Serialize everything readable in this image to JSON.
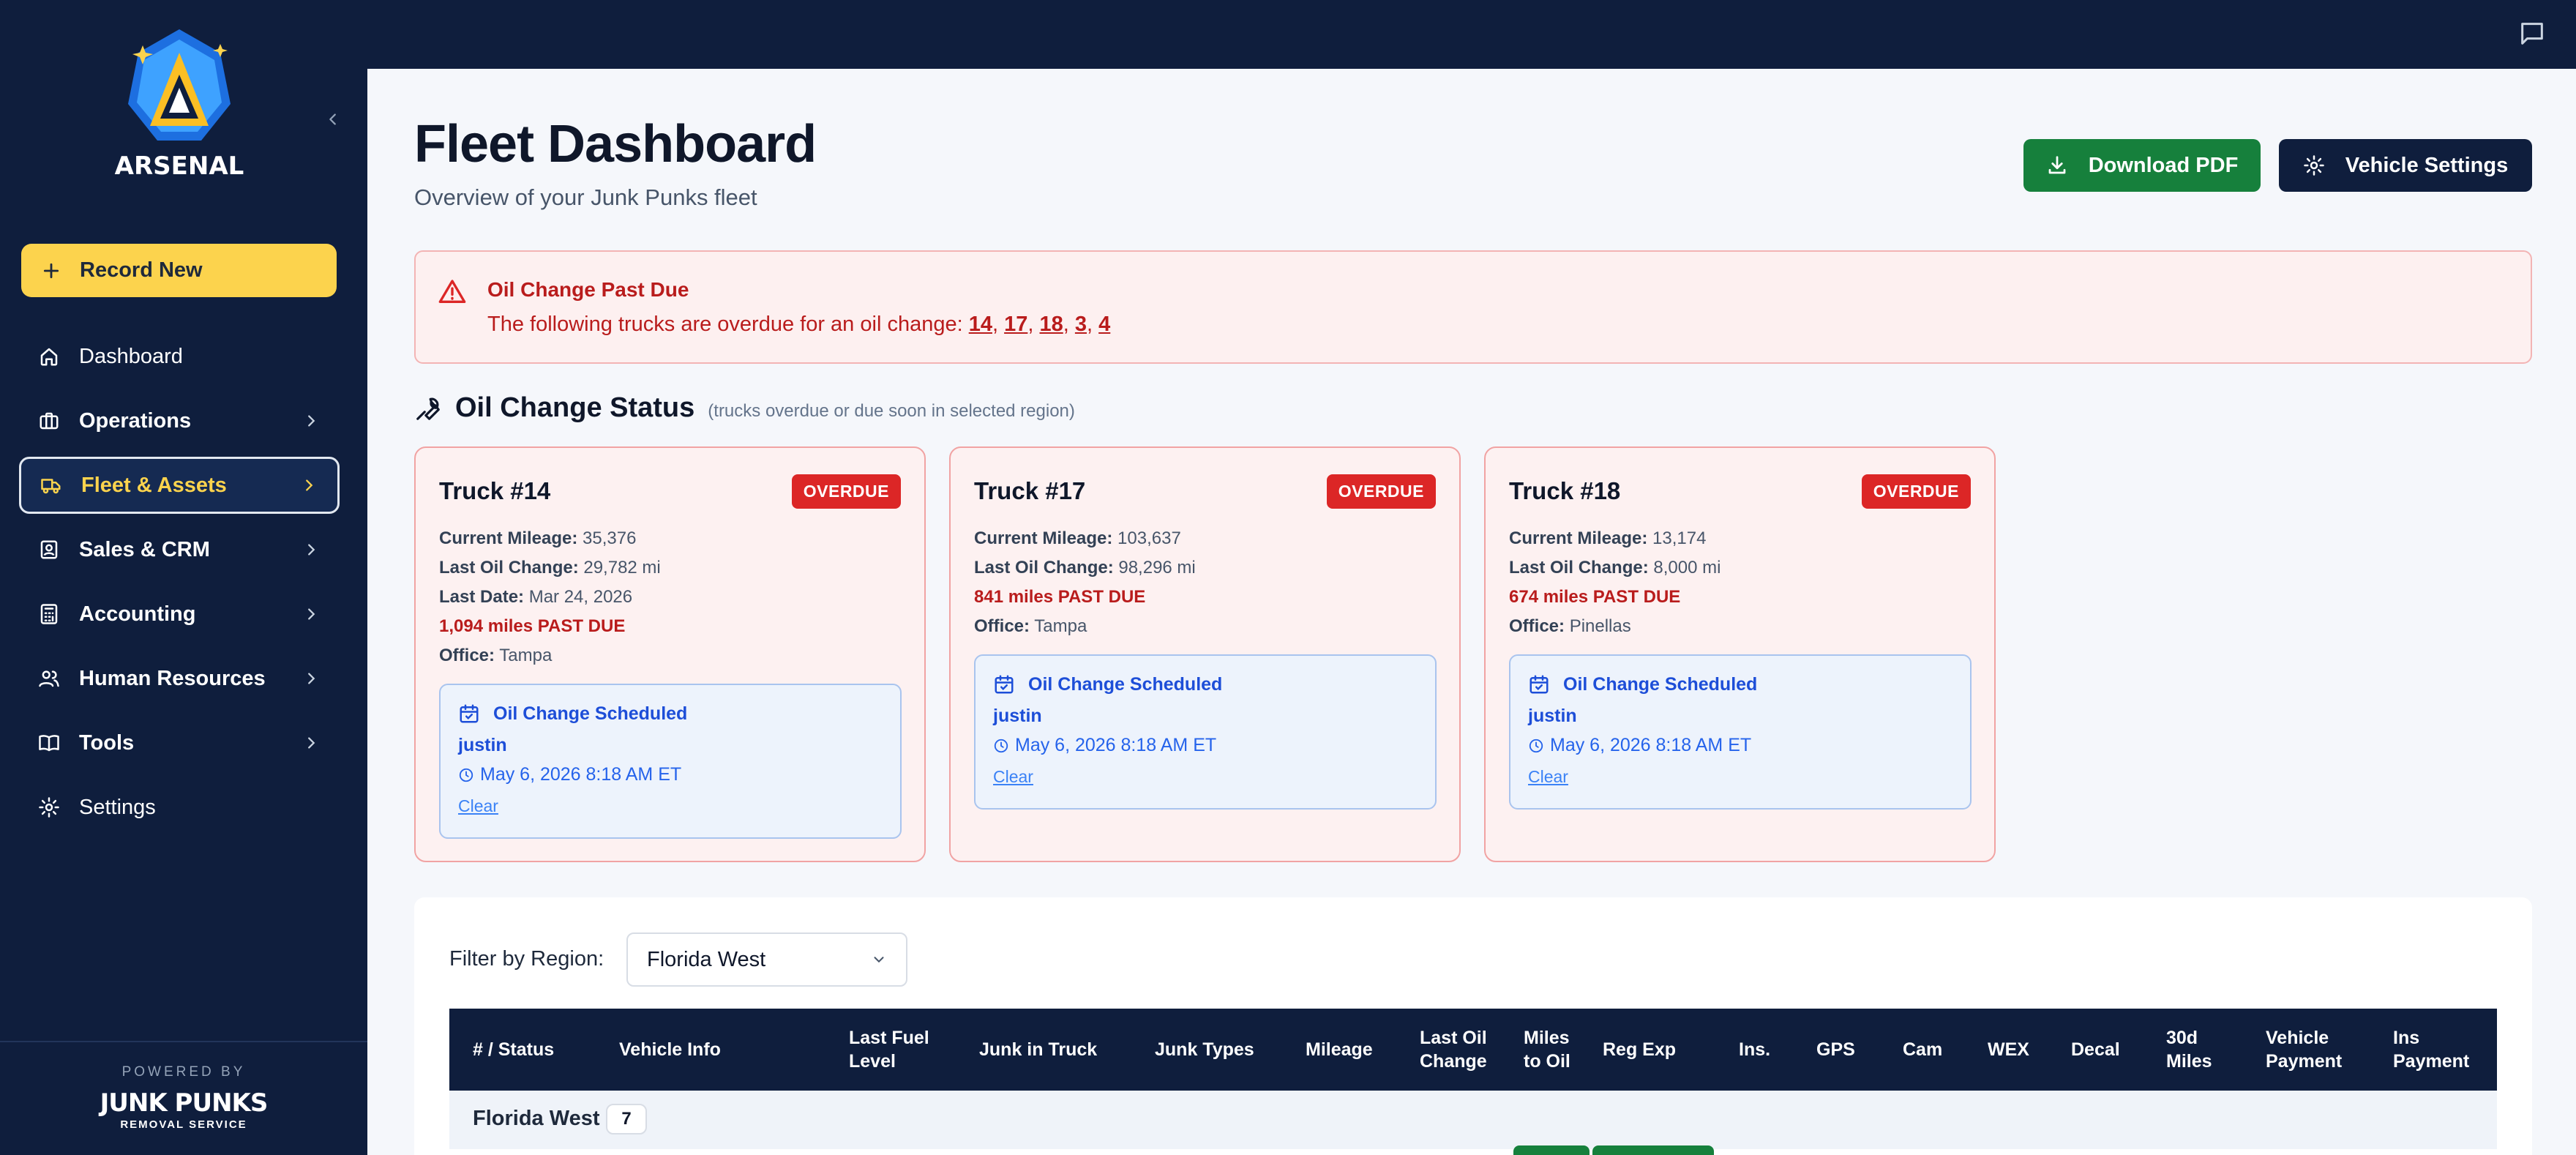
{
  "sidebar": {
    "brand": "ARSENAL",
    "record_new": "Record New",
    "items": [
      {
        "label": "Dashboard",
        "icon": "home-icon",
        "chevron": false
      },
      {
        "label": "Operations",
        "icon": "briefcase-icon",
        "chevron": true
      },
      {
        "label": "Fleet & Assets",
        "icon": "truck-icon",
        "chevron": true,
        "active": true
      },
      {
        "label": "Sales & CRM",
        "icon": "contact-icon",
        "chevron": true
      },
      {
        "label": "Accounting",
        "icon": "calculator-icon",
        "chevron": true
      },
      {
        "label": "Human Resources",
        "icon": "users-icon",
        "chevron": true
      },
      {
        "label": "Tools",
        "icon": "book-icon",
        "chevron": true
      },
      {
        "label": "Settings",
        "icon": "gear-icon",
        "chevron": false
      }
    ],
    "powered_by": "POWERED BY",
    "footer_logo": "JUNK PUNKS",
    "footer_logo_sub": "REMOVAL SERVICE"
  },
  "header": {
    "title": "Fleet Dashboard",
    "subtitle": "Overview of your Junk Punks fleet",
    "download_pdf": "Download PDF",
    "vehicle_settings": "Vehicle Settings"
  },
  "alert": {
    "title": "Oil Change Past Due",
    "text": "The following trucks are overdue for an oil change: ",
    "trucks": [
      "14",
      "17",
      "18",
      "3",
      "4"
    ],
    "sep": ", "
  },
  "oil_status": {
    "title": "Oil Change Status",
    "note": "(trucks overdue or due soon in selected region)"
  },
  "cards": [
    {
      "title": "Truck #14",
      "badge": "OVERDUE",
      "mileage_label": "Current Mileage:",
      "mileage": "35,376",
      "last_label": "Last Oil Change:",
      "last": "29,782 mi",
      "date_label": "Last Date:",
      "date": "Mar 24, 2026",
      "due": "1,094 miles PAST DUE",
      "office_label": "Office:",
      "office": "Tampa",
      "sched_title": "Oil Change Scheduled",
      "sched_user": "justin",
      "sched_time": "May 6, 2026 8:18 AM ET",
      "clear": "Clear"
    },
    {
      "title": "Truck #17",
      "badge": "OVERDUE",
      "mileage_label": "Current Mileage:",
      "mileage": "103,637",
      "last_label": "Last Oil Change:",
      "last": "98,296 mi",
      "due": "841 miles PAST DUE",
      "office_label": "Office:",
      "office": "Tampa",
      "sched_title": "Oil Change Scheduled",
      "sched_user": "justin",
      "sched_time": "May 6, 2026 8:18 AM ET",
      "clear": "Clear"
    },
    {
      "title": "Truck #18",
      "badge": "OVERDUE",
      "mileage_label": "Current Mileage:",
      "mileage": "13,174",
      "last_label": "Last Oil Change:",
      "last": "8,000 mi",
      "due": "674 miles PAST DUE",
      "office_label": "Office:",
      "office": "Pinellas",
      "sched_title": "Oil Change Scheduled",
      "sched_user": "justin",
      "sched_time": "May 6, 2026 8:18 AM ET",
      "clear": "Clear"
    }
  ],
  "filter": {
    "label": "Filter by Region:",
    "value": "Florida West"
  },
  "table": {
    "columns": [
      "# / Status",
      "Vehicle Info",
      "Last Fuel Level",
      "Junk in Truck",
      "Junk Types",
      "Mileage",
      "Last Oil Change",
      "Miles to Oil",
      "Reg Exp",
      "Ins.",
      "GPS",
      "Cam",
      "WEX",
      "Decal",
      "30d Miles",
      "Vehicle Payment",
      "Ins Payment"
    ],
    "group": {
      "name": "Florida West",
      "count": "7"
    }
  },
  "colors": {
    "navy": "#0f1e3d",
    "accent_yellow": "#fcd34d",
    "success_green": "#16803c",
    "danger_red": "#dc2626"
  }
}
